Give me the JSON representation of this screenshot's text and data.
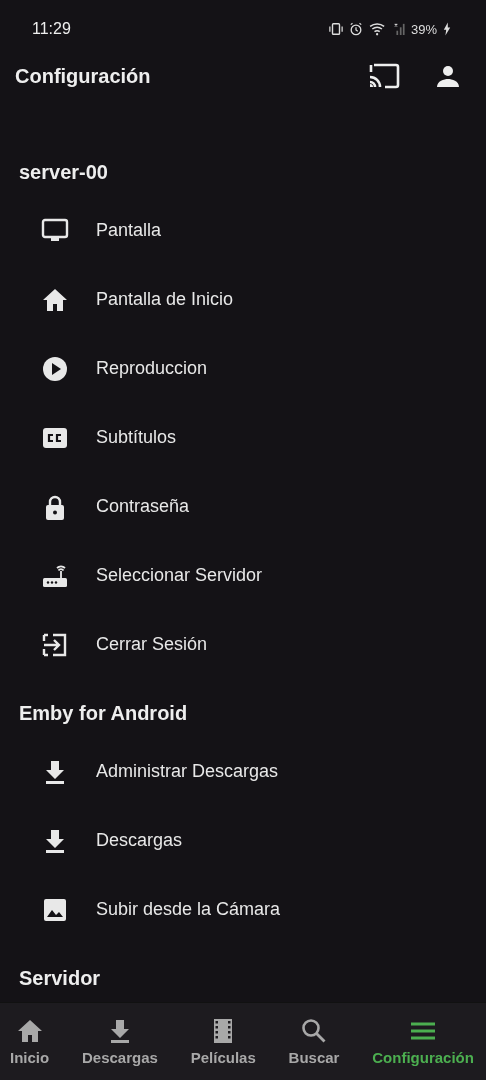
{
  "status_bar": {
    "time": "11:29",
    "battery": "39%"
  },
  "app_bar": {
    "title": "Configuración"
  },
  "sections": [
    {
      "title": "server-00",
      "items": [
        {
          "label": "Pantalla"
        },
        {
          "label": "Pantalla de Inicio"
        },
        {
          "label": "Reproduccion"
        },
        {
          "label": "Subtítulos"
        },
        {
          "label": "Contraseña"
        },
        {
          "label": "Seleccionar Servidor"
        },
        {
          "label": "Cerrar Sesión"
        }
      ]
    },
    {
      "title": "Emby for Android",
      "items": [
        {
          "label": "Administrar Descargas"
        },
        {
          "label": "Descargas"
        },
        {
          "label": "Subir desde la Cámara"
        }
      ]
    },
    {
      "title": "Servidor"
    }
  ],
  "bottom_nav": [
    {
      "label": "Inicio",
      "selected": false
    },
    {
      "label": "Descargas",
      "selected": false
    },
    {
      "label": "Películas",
      "selected": false
    },
    {
      "label": "Buscar",
      "selected": false
    },
    {
      "label": "Configuración",
      "selected": true
    }
  ]
}
